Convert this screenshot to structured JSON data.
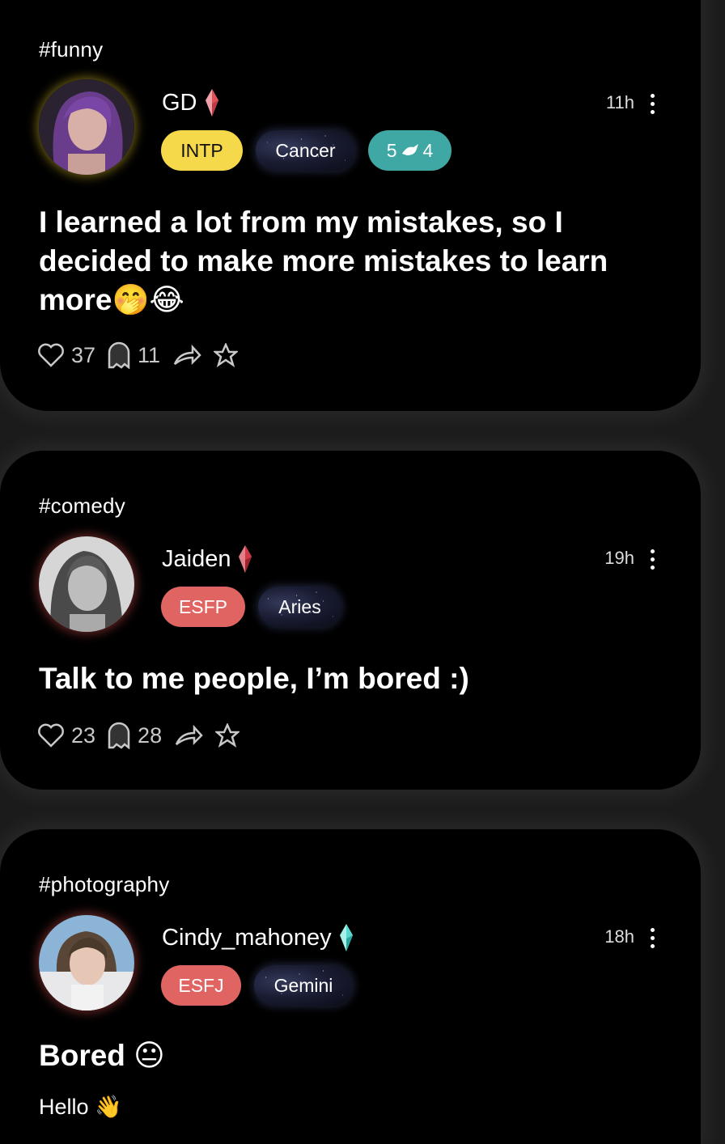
{
  "posts": [
    {
      "tag": "#funny",
      "username": "GD",
      "time": "11h",
      "mbti": "INTP",
      "zodiac": "Cancer",
      "badge_left": "5",
      "badge_right": "4",
      "text": "I learned a lot from my mistakes, so I decided to make more mistakes to learn more🤭😂",
      "likes": "37",
      "comments": "11"
    },
    {
      "tag": "#comedy",
      "username": "Jaiden",
      "time": "19h",
      "mbti": "ESFP",
      "zodiac": "Aries",
      "text": "Talk to me people, I’m bored :)",
      "likes": "23",
      "comments": "28"
    },
    {
      "tag": "#photography",
      "username": "Cindy_mahoney",
      "time": "18h",
      "mbti": "ESFJ",
      "zodiac": "Gemini",
      "title": "Bored 😐",
      "body": "Hello 👋"
    }
  ],
  "colors": {
    "mbti_intp": "#f6d94a",
    "mbti_es": "#e06462",
    "badge_teal": "#3fa7a4",
    "gem_red": "#e0525a",
    "gem_cyan": "#58d6d0"
  },
  "icons": [
    "heart-icon",
    "ghost-icon",
    "share-icon",
    "star-icon",
    "more-vertical-icon",
    "gem-icon",
    "bird-icon"
  ]
}
